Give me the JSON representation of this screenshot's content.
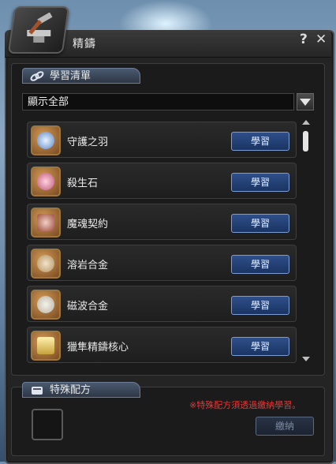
{
  "window": {
    "title": "精鑄",
    "help": "?",
    "close": "✕"
  },
  "learn_list": {
    "header": "學習清單",
    "filter": "顯示全部",
    "items": [
      {
        "name": "守護之羽",
        "button": "學習",
        "icon": "feather-icon"
      },
      {
        "name": "殺生石",
        "button": "學習",
        "icon": "stone-icon"
      },
      {
        "name": "魔魂契約",
        "button": "學習",
        "icon": "scroll-icon"
      },
      {
        "name": "溶岩合金",
        "button": "學習",
        "icon": "alloy-icon"
      },
      {
        "name": "磁波合金",
        "button": "學習",
        "icon": "alloy-icon"
      },
      {
        "name": "獵隼精鑄核心",
        "button": "學習",
        "icon": "core-icon"
      }
    ]
  },
  "special": {
    "header": "特殊配方",
    "notice": "※特殊配方須透過繳納學習。",
    "button": "繳納"
  },
  "colors": {
    "accent": "#2f4f8a",
    "notice": "#e53a3a"
  }
}
